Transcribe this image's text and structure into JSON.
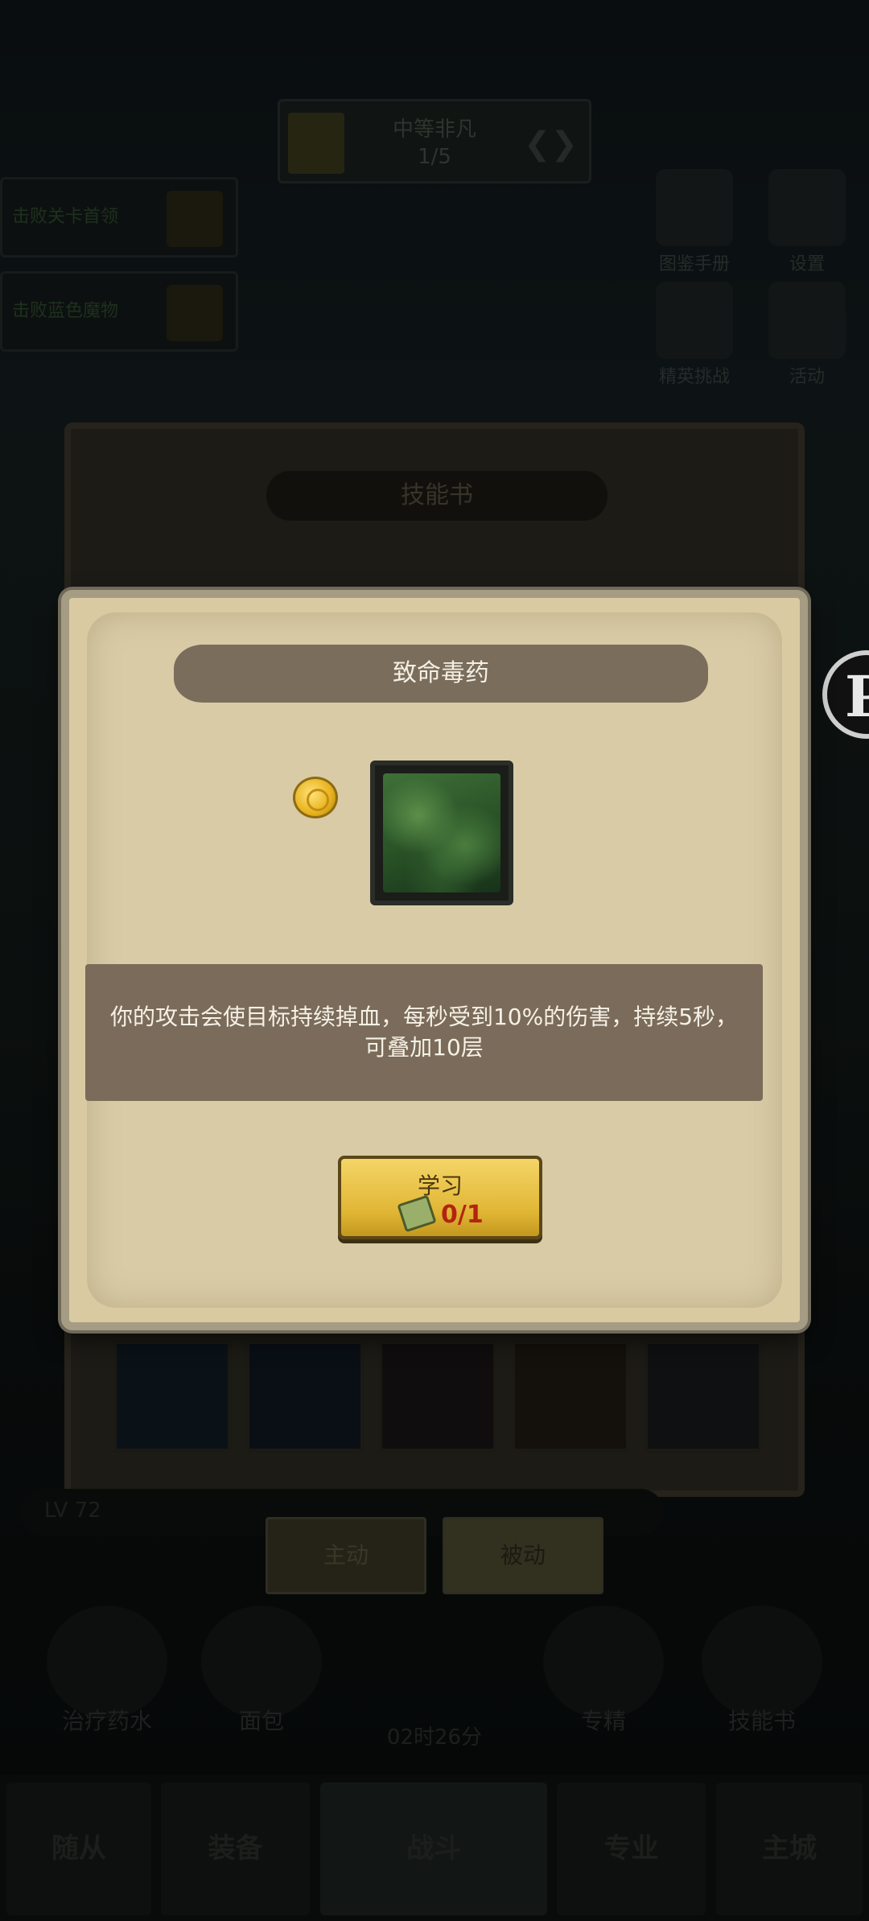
{
  "background": {
    "stage_banner": {
      "title": "中等非凡",
      "progress": "1/5"
    },
    "task_cards": [
      {
        "text": "击败关卡首领"
      },
      {
        "text": "击败蓝色魔物"
      }
    ],
    "side_icons": [
      {
        "label": "图鉴手册",
        "icon": "book-icon"
      },
      {
        "label": "设置",
        "icon": "gear-icon"
      },
      {
        "label": "精英挑战",
        "icon": "eagle-icon"
      },
      {
        "label": "活动",
        "icon": "calendar-icon"
      }
    ],
    "panel_title": "技能书",
    "tabs": {
      "active_label": "主动",
      "passive_label": "被动"
    },
    "bottom_items": [
      {
        "label": "治疗药水"
      },
      {
        "label": "面包"
      },
      {
        "label": "专精"
      },
      {
        "label": "技能书"
      }
    ],
    "timer": "02时26分",
    "level": "LV 72",
    "nav": [
      "随从",
      "装备",
      "战斗",
      "专业",
      "主城"
    ]
  },
  "dialog": {
    "title": "致命毒药",
    "description": "你的攻击会使目标持续掉血，每秒受到10%的伤害，持续5秒，可叠加10层",
    "learn_button": {
      "label": "学习",
      "count": "0/1"
    }
  },
  "colors": {
    "dialog_bg": "#d9caa2",
    "title_bar": "#7a6d5c",
    "button_gold": "#e0b534",
    "count_red": "#b3240f"
  }
}
